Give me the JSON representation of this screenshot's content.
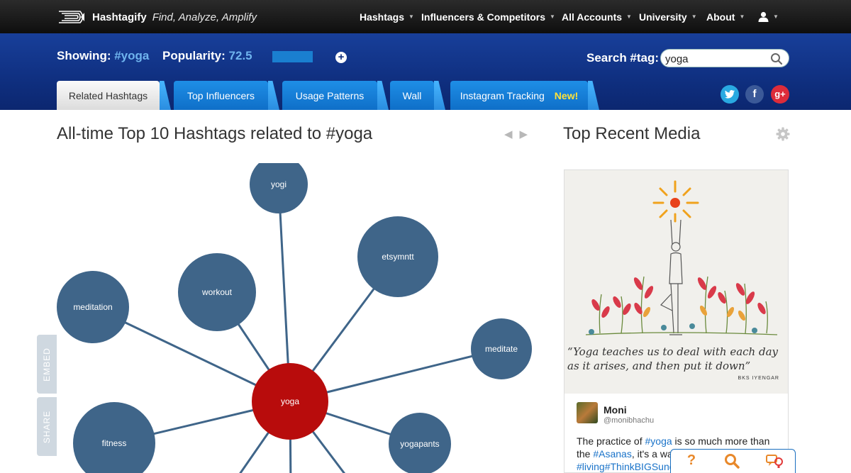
{
  "brand": {
    "name": "Hashtagify",
    "tagline": "Find, Analyze, Amplify"
  },
  "topnav": {
    "items": [
      {
        "label": "Hashtags"
      },
      {
        "label": "Influencers & Competitors"
      },
      {
        "label": "All Accounts"
      },
      {
        "label": "University"
      },
      {
        "label": "About"
      }
    ],
    "user_icon": "user-icon"
  },
  "header": {
    "showing_label": "Showing:",
    "showing_value": "#yoga",
    "popularity_label": "Popularity:",
    "popularity_value": "72.5",
    "popularity_fraction": 0.725,
    "search_label": "Search #tag:",
    "search_value": "yoga"
  },
  "tabs": [
    {
      "label": "Related Hashtags",
      "active": true
    },
    {
      "label": "Top Influencers",
      "active": false
    },
    {
      "label": "Usage Patterns",
      "active": false
    },
    {
      "label": "Wall",
      "active": false
    },
    {
      "label": "Instagram Tracking",
      "active": false
    }
  ],
  "new_badge": "New!",
  "social": [
    {
      "icon": "twitter-icon",
      "glyph": "t",
      "color": "#29a9e1"
    },
    {
      "icon": "facebook-icon",
      "glyph": "f",
      "color": "#3b5998"
    },
    {
      "icon": "google-plus-icon",
      "glyph": "g+",
      "color": "#dd2c3a"
    }
  ],
  "main": {
    "title": "All-time Top 10 Hashtags related to #yoga",
    "side_tabs": [
      "EMBED",
      "SHARE"
    ]
  },
  "graph": {
    "center": "yoga",
    "nodes": [
      "yogi",
      "etsymntt",
      "workout",
      "meditation",
      "meditate",
      "fitness",
      "yogapants"
    ],
    "colors": {
      "center": "#b80c0c",
      "node": "#3f6589",
      "edge": "#3f6589"
    }
  },
  "media": {
    "title": "Top Recent Media",
    "quote": "“Yoga teaches us to deal with each day as it arises, and then put it down”",
    "quote_author": "BKS IYENGAR",
    "user_name": "Moni",
    "user_handle": "@monibhachu",
    "tweet_parts": [
      {
        "text": "The practice of ",
        "tag": false
      },
      {
        "text": "#yoga",
        "tag": true
      },
      {
        "text": " is so much more than the ",
        "tag": false
      },
      {
        "text": "#Asanas",
        "tag": true
      },
      {
        "text": ", it's a way of ",
        "tag": false
      },
      {
        "text": "#living",
        "tag": true
      },
      {
        "text": "#ThinkBIGSund",
        "tag": true
      }
    ]
  },
  "helpbar": {
    "items": [
      {
        "icon": "question-icon",
        "glyph": "?"
      },
      {
        "icon": "search-icon",
        "glyph": ""
      },
      {
        "icon": "chat-icon",
        "glyph": ""
      }
    ]
  }
}
